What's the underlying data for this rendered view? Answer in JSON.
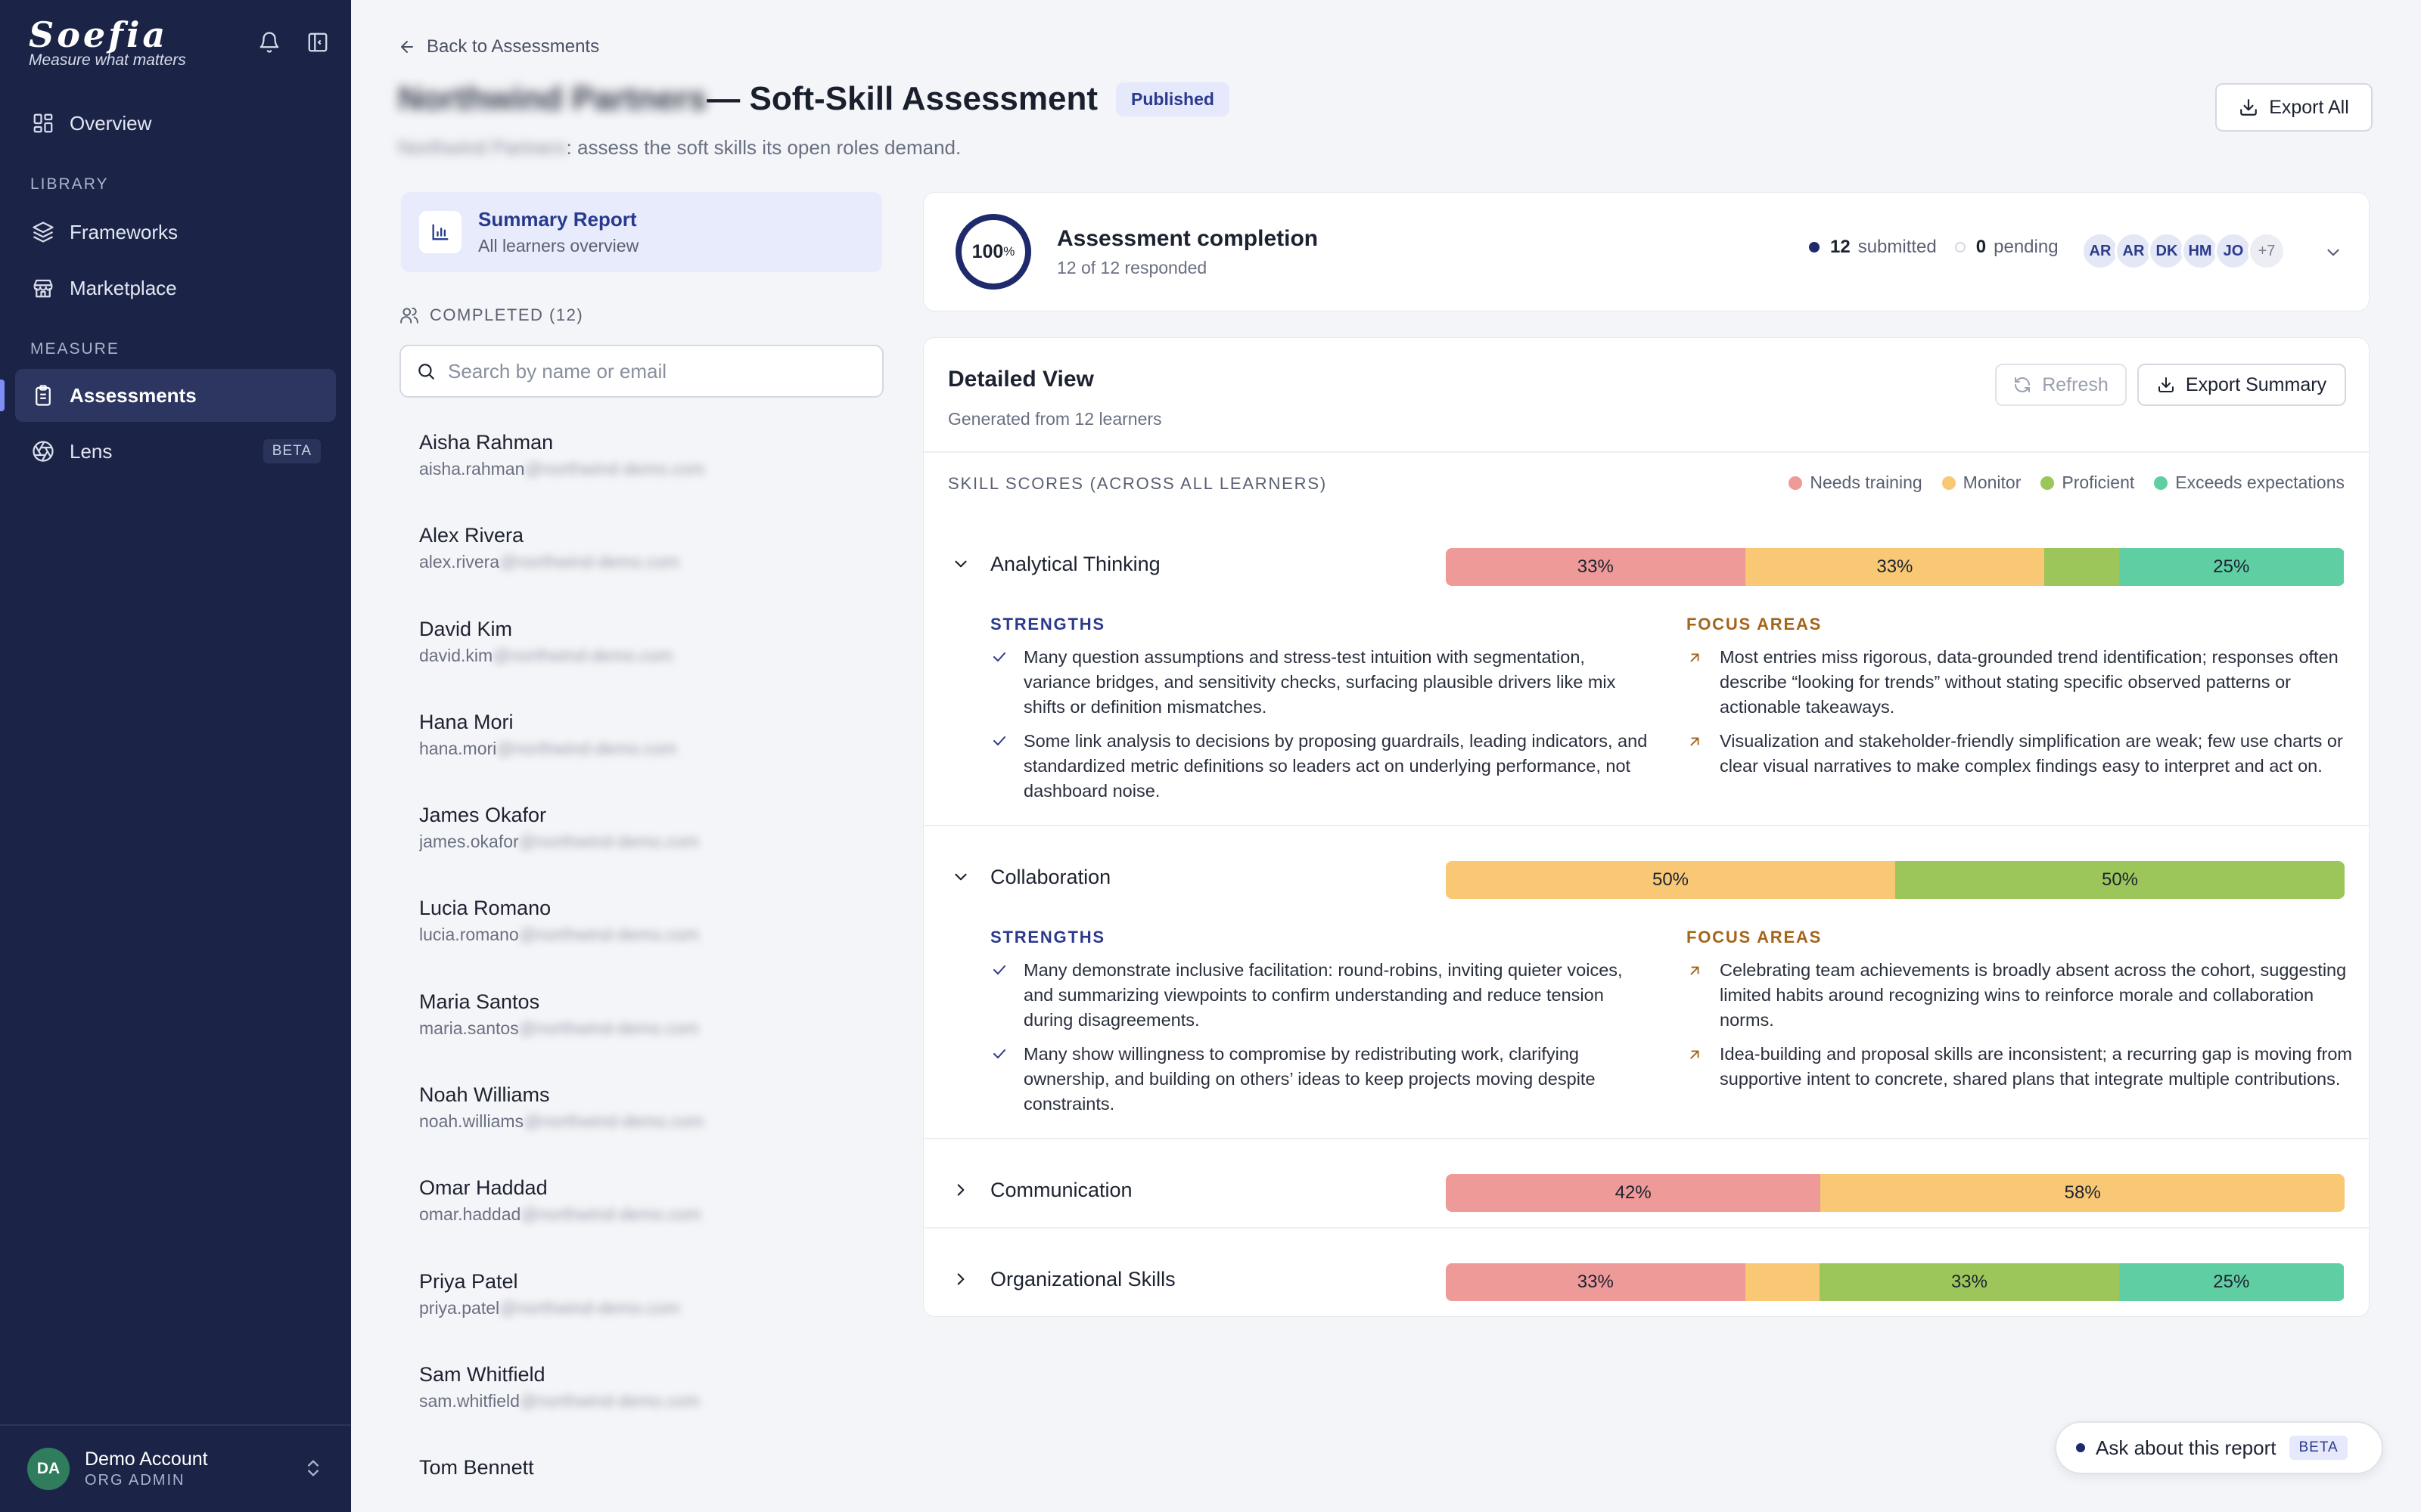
{
  "brand": {
    "name": "Soefia",
    "tagline": "Measure what matters"
  },
  "sidebar": {
    "overview": "Overview",
    "library_label": "LIBRARY",
    "frameworks": "Frameworks",
    "marketplace": "Marketplace",
    "measure_label": "MEASURE",
    "assessments": "Assessments",
    "lens": "Lens",
    "lens_badge": "BETA",
    "account": {
      "initials": "DA",
      "name": "Demo Account",
      "role": "ORG ADMIN"
    }
  },
  "header": {
    "back": "Back to Assessments",
    "org_name": "Northwind Partners",
    "title": " — Soft-Skill Assessment",
    "status": "Published",
    "subtitle_org": "Northwind Partners",
    "subtitle": ": assess the soft skills its open roles demand.",
    "export_all": "Export All"
  },
  "left": {
    "summary_title": "Summary Report",
    "summary_sub": "All learners overview",
    "completed_label": "COMPLETED (12)",
    "search_placeholder": "Search by name or email",
    "email_domain": "@northwind-demo.com",
    "learners": [
      {
        "name": "Aisha Rahman",
        "email": "aisha.rahman"
      },
      {
        "name": "Alex Rivera",
        "email": "alex.rivera"
      },
      {
        "name": "David Kim",
        "email": "david.kim"
      },
      {
        "name": "Hana Mori",
        "email": "hana.mori"
      },
      {
        "name": "James Okafor",
        "email": "james.okafor"
      },
      {
        "name": "Lucia Romano",
        "email": "lucia.romano"
      },
      {
        "name": "Maria Santos",
        "email": "maria.santos"
      },
      {
        "name": "Noah Williams",
        "email": "noah.williams"
      },
      {
        "name": "Omar Haddad",
        "email": "omar.haddad"
      },
      {
        "name": "Priya Patel",
        "email": "priya.patel"
      },
      {
        "name": "Sam Whitfield",
        "email": "sam.whitfield"
      },
      {
        "name": "Tom Bennett",
        "email": ""
      }
    ]
  },
  "completion": {
    "percent": "100",
    "percent_sign": "%",
    "percent_value": 100,
    "title": "Assessment completion",
    "sub": "12 of 12 responded",
    "submitted_count": "12",
    "submitted_label": "submitted",
    "pending_count": "0",
    "pending_label": "pending",
    "avatars": [
      "AR",
      "AR",
      "DK",
      "HM",
      "JO"
    ],
    "more": "+7"
  },
  "detail": {
    "title": "Detailed View",
    "sub": "Generated from 12 learners",
    "refresh": "Refresh",
    "export_summary": "Export Summary",
    "scores_label": "SKILL SCORES (ACROSS ALL LEARNERS)",
    "legend": [
      {
        "label": "Needs training",
        "color": "#ee9a98"
      },
      {
        "label": "Monitor",
        "color": "#f8c875"
      },
      {
        "label": "Proficient",
        "color": "#9cc65a"
      },
      {
        "label": "Exceeds expectations",
        "color": "#5fcfa3"
      }
    ],
    "strengths_label": "STRENGTHS",
    "focus_label": "FOCUS AREAS",
    "skills": [
      {
        "name": "Analytical Thinking",
        "expanded": true,
        "segments": [
          {
            "level": "Needs training",
            "value": 33.3,
            "label": "33%"
          },
          {
            "level": "Monitor",
            "value": 33.3,
            "label": "33%"
          },
          {
            "level": "Proficient",
            "value": 8.3,
            "label": ""
          },
          {
            "level": "Exceeds expectations",
            "value": 25,
            "label": "25%"
          }
        ],
        "strengths": [
          "Many question assumptions and stress-test intuition with segmentation, variance bridges, and sensitivity checks, surfacing plausible drivers like mix shifts or definition mismatches.",
          "Some link analysis to decisions by proposing guardrails, leading indicators, and standardized metric definitions so leaders act on underlying performance, not dashboard noise."
        ],
        "focus": [
          "Most entries miss rigorous, data-grounded trend identification; responses often describe “looking for trends” without stating specific observed patterns or actionable takeaways.",
          "Visualization and stakeholder-friendly simplification are weak; few use charts or clear visual narratives to make complex findings easy to interpret and act on."
        ]
      },
      {
        "name": "Collaboration",
        "expanded": true,
        "segments": [
          {
            "level": "Monitor",
            "value": 50,
            "label": "50%"
          },
          {
            "level": "Proficient",
            "value": 50,
            "label": "50%"
          }
        ],
        "strengths": [
          "Many demonstrate inclusive facilitation: round-robins, inviting quieter voices, and summarizing viewpoints to confirm understanding and reduce tension during disagreements.",
          "Many show willingness to compromise by redistributing work, clarifying ownership, and building on others’ ideas to keep projects moving despite constraints."
        ],
        "focus": [
          "Celebrating team achievements is broadly absent across the cohort, suggesting limited habits around recognizing wins to reinforce morale and collaboration norms.",
          "Idea-building and proposal skills are inconsistent; a recurring gap is moving from supportive intent to concrete, shared plans that integrate multiple contributions."
        ]
      },
      {
        "name": "Communication",
        "expanded": false,
        "segments": [
          {
            "level": "Needs training",
            "value": 41.7,
            "label": "42%"
          },
          {
            "level": "Monitor",
            "value": 58.3,
            "label": "58%"
          }
        ]
      },
      {
        "name": "Organizational Skills",
        "expanded": false,
        "segments": [
          {
            "level": "Needs training",
            "value": 33.3,
            "label": "33%"
          },
          {
            "level": "Monitor",
            "value": 8.3,
            "label": ""
          },
          {
            "level": "Proficient",
            "value": 33.3,
            "label": "33%"
          },
          {
            "level": "Exceeds expectations",
            "value": 25,
            "label": "25%"
          }
        ]
      }
    ]
  },
  "ask": {
    "label": "Ask about this report",
    "badge": "BETA"
  }
}
